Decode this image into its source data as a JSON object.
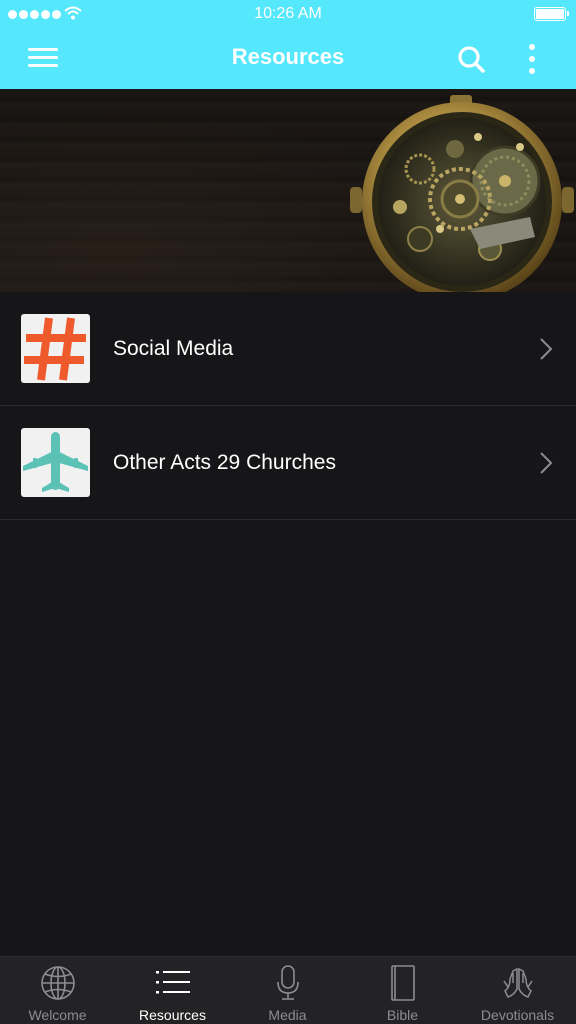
{
  "status_bar": {
    "time": "10:26 AM",
    "signal_icon": "signal-dots-icon",
    "wifi_icon": "wifi-icon",
    "battery_icon": "battery-icon"
  },
  "nav": {
    "title": "Resources",
    "menu_icon": "hamburger-menu-icon",
    "search_icon": "search-icon",
    "more_icon": "more-vertical-icon"
  },
  "banner": {
    "image": "pocket-watch-mechanism-on-wood"
  },
  "list": {
    "items": [
      {
        "label": "Social Media",
        "icon": "hashtag-icon",
        "icon_color": "#ef5a2c"
      },
      {
        "label": "Other Acts 29 Churches",
        "icon": "airplane-icon",
        "icon_color": "#5cc2b6"
      }
    ]
  },
  "tabs": [
    {
      "label": "Welcome",
      "icon": "globe-icon",
      "active": false
    },
    {
      "label": "Resources",
      "icon": "list-icon",
      "active": true
    },
    {
      "label": "Media",
      "icon": "microphone-icon",
      "active": false
    },
    {
      "label": "Bible",
      "icon": "book-icon",
      "active": false
    },
    {
      "label": "Devotionals",
      "icon": "praying-hands-icon",
      "active": false
    }
  ],
  "colors": {
    "header": "#55e7fc",
    "background": "#161618",
    "tabbar": "#232325",
    "tab_inactive": "#8d8d90",
    "tab_active": "#ffffff"
  }
}
